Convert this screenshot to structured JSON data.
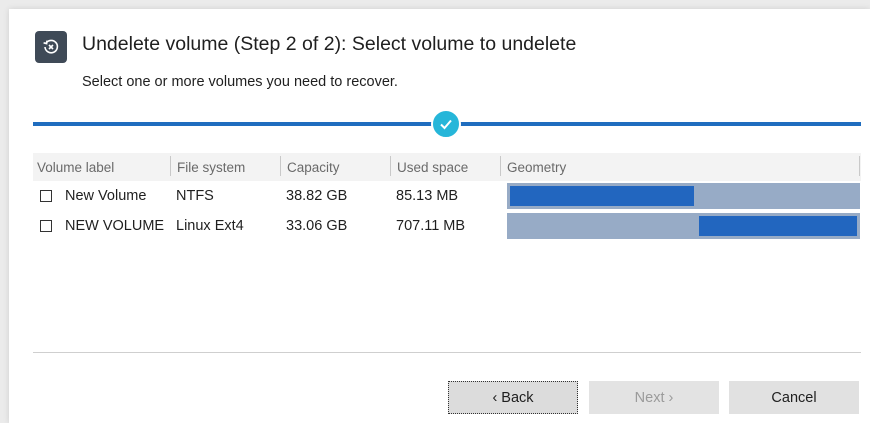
{
  "dialog": {
    "title": "Undelete volume (Step 2 of 2): Select volume to undelete",
    "subtitle": "Select one or more volumes you need to recover.",
    "title_icon": "undelete-icon",
    "step_status_icon": "check-icon"
  },
  "table": {
    "columns": [
      "Volume label",
      "File system",
      "Capacity",
      "Used space",
      "Geometry"
    ],
    "rows": [
      {
        "checked": false,
        "label": "New Volume",
        "file_system": "NTFS",
        "capacity": "38.82 GB",
        "used_space": "85.13 MB",
        "geometry": {
          "start": 0.0,
          "end": 0.53
        }
      },
      {
        "checked": false,
        "label": "NEW VOLUME",
        "file_system": "Linux Ext4",
        "capacity": "33.06 GB",
        "used_space": "707.11 MB",
        "geometry": {
          "start": 0.545,
          "end": 1.0
        }
      }
    ]
  },
  "buttons": {
    "back": "‹ Back",
    "next": "Next ›",
    "cancel": "Cancel"
  },
  "colors": {
    "accent": "#1f6dbf",
    "check_circle": "#26b6d9",
    "geometry_background": "#97abc6",
    "geometry_fill": "#2266bf",
    "title_icon_bg": "#3f4a57"
  }
}
